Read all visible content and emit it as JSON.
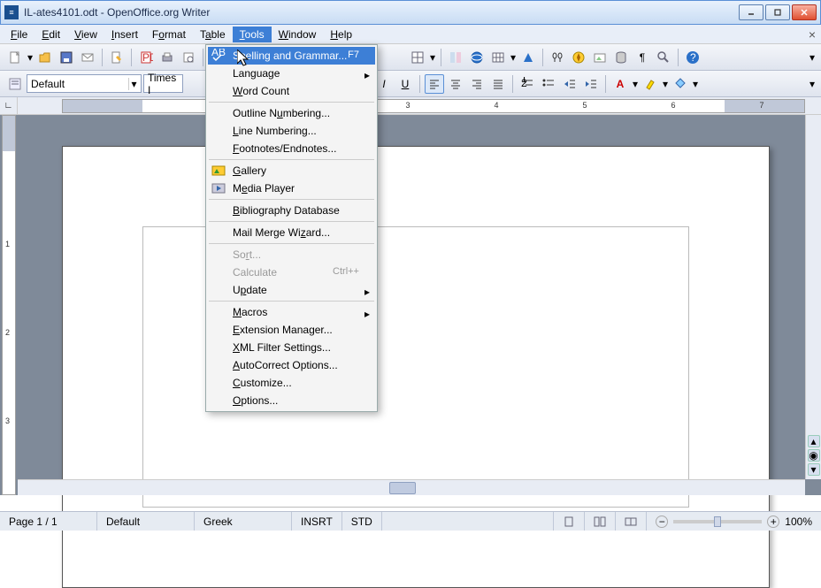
{
  "title": "IL-ates4101.odt - OpenOffice.org Writer",
  "menus": [
    "File",
    "Edit",
    "View",
    "Insert",
    "Format",
    "Table",
    "Tools",
    "Window",
    "Help"
  ],
  "active_menu": "Tools",
  "style_combo": "Default",
  "font_combo": "Times I",
  "ruler_numbers": [
    "3",
    "4",
    "5",
    "6",
    "7"
  ],
  "dropdown": {
    "spelling": "Spelling and Grammar...",
    "spelling_shortcut": "F7",
    "language": "Language",
    "wordcount": "Word Count",
    "outline": "Outline Numbering...",
    "linenum": "Line Numbering...",
    "footnotes": "Footnotes/Endnotes...",
    "gallery": "Gallery",
    "media": "Media Player",
    "biblio": "Bibliography Database",
    "mailmerge": "Mail Merge Wizard...",
    "sort": "Sort...",
    "calculate": "Calculate",
    "calc_shortcut": "Ctrl++",
    "update": "Update",
    "macros": "Macros",
    "extensions": "Extension Manager...",
    "xmlfilter": "XML Filter Settings...",
    "autocorrect": "AutoCorrect Options...",
    "customize": "Customize...",
    "options": "Options..."
  },
  "status": {
    "page": "Page 1 / 1",
    "style": "Default",
    "lang": "Greek",
    "insert": "INSRT",
    "sel": "STD",
    "zoom": "100%"
  },
  "icons": {
    "minus": "−",
    "plus": "+"
  }
}
